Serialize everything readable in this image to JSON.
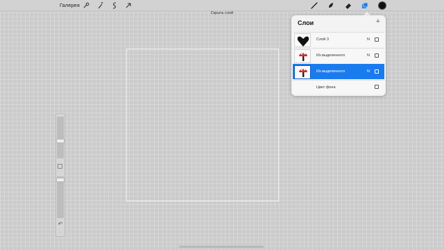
{
  "top_bar": {
    "gallery_label": "Галерея",
    "tools_left": [
      {
        "icon": "wrench-icon"
      },
      {
        "icon": "magic-wand-icon"
      },
      {
        "icon": "selection-icon"
      },
      {
        "icon": "move-arrow-icon"
      }
    ],
    "tools_right": [
      {
        "icon": "brush-icon"
      },
      {
        "icon": "smudge-icon"
      },
      {
        "icon": "eraser-icon"
      },
      {
        "icon": "layers-icon"
      }
    ],
    "color_swatch": "#111111",
    "accent_color": "#1a7bef"
  },
  "hint": {
    "hide_layer_label": "Скрыть слой"
  },
  "side_panel": {
    "icons": [
      "modify-square-icon",
      "undo-icon",
      "redo-icon"
    ]
  },
  "layers_panel": {
    "title": "Слои",
    "add_label": "+",
    "layers": [
      {
        "name": "Слой 3",
        "blend": "N",
        "thumb": "black-heart",
        "selected": false
      },
      {
        "name": "Из выделенного",
        "blend": "N",
        "thumb": "red-mushroom",
        "selected": false
      },
      {
        "name": "Из выделенного",
        "blend": "N",
        "thumb": "red-mushroom",
        "selected": true
      },
      {
        "name": "Цвет фона",
        "blend": "",
        "thumb": "none",
        "selected": false
      }
    ]
  }
}
